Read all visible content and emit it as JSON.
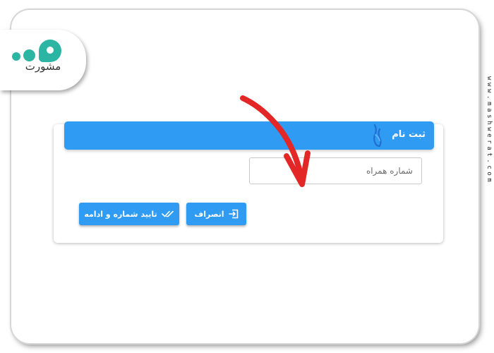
{
  "logo": {
    "text": "مشورت",
    "icon": "brand-logo",
    "color": "#2cb5a3"
  },
  "side_url": "www.mashwerat.com",
  "form": {
    "header": {
      "title": "ثبت نام",
      "icon": "hand-pointer-icon"
    },
    "phone_input": {
      "placeholder": "شماره همراه",
      "value": ""
    },
    "buttons": {
      "cancel": {
        "label": "انصراف",
        "icon": "exit-icon"
      },
      "confirm": {
        "label": "تایید شماره و ادامه",
        "icon": "double-check-icon"
      }
    }
  },
  "annotation": {
    "icon": "red-arrow-icon",
    "color": "#e32626"
  },
  "colors": {
    "accent": "#2f9bf2",
    "brand": "#2cb5a3"
  }
}
